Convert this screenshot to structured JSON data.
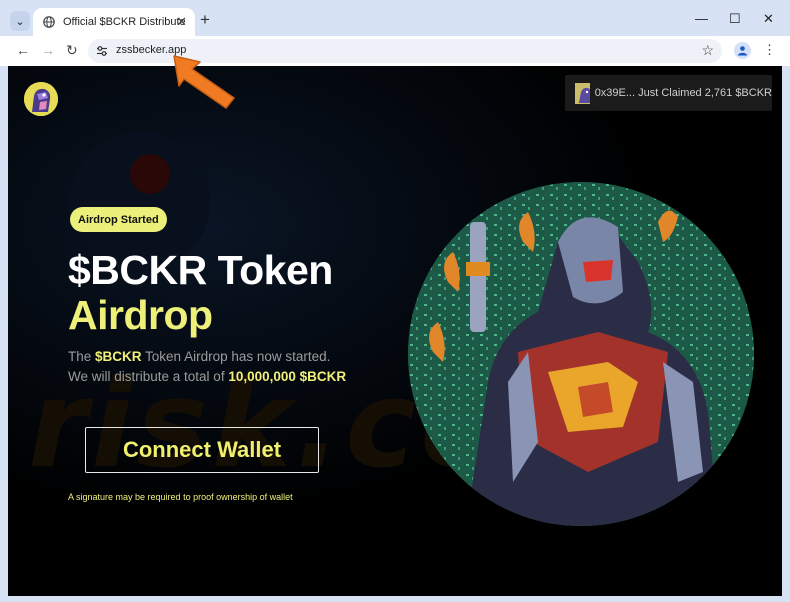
{
  "browser": {
    "tab_title": "Official $BCKR Distribute",
    "url": "zssbecker.app",
    "new_tab_glyph": "+",
    "tab_close_glyph": "✕",
    "minimize_glyph": "—",
    "maximize_glyph": "☐",
    "close_glyph": "✕",
    "back_glyph": "←",
    "forward_glyph": "→",
    "reload_glyph": "↻",
    "bookmark_glyph": "☆",
    "menu_glyph": "⋮",
    "tab_search_glyph": "⌄"
  },
  "page": {
    "claim_notice": "0x39E... Just Claimed 2,761 $BCKR",
    "badge": "Airdrop Started",
    "headline_line1": "$BCKR Token",
    "headline_line2": "Airdrop",
    "desc_prefix": "The ",
    "desc_token": "$BCKR",
    "desc_mid": " Token Airdrop has now started.",
    "desc_line2_prefix": "We will distribute a total of ",
    "desc_amount": "10,000,000 $BCKR",
    "connect_label": "Connect Wallet",
    "signature_note": "A signature may be required to proof ownership of wallet",
    "watermark_text": "risk.co"
  },
  "colors": {
    "accent_yellow": "#eef07a",
    "page_bg": "#000000",
    "chrome_bg": "#d7e3f4",
    "arrow_orange": "#f07b22"
  },
  "icons": {
    "tab_favicon": "globe-icon",
    "site_settings": "tune-icon",
    "profile": "person-icon",
    "annotation": "orange-arrow-icon"
  }
}
